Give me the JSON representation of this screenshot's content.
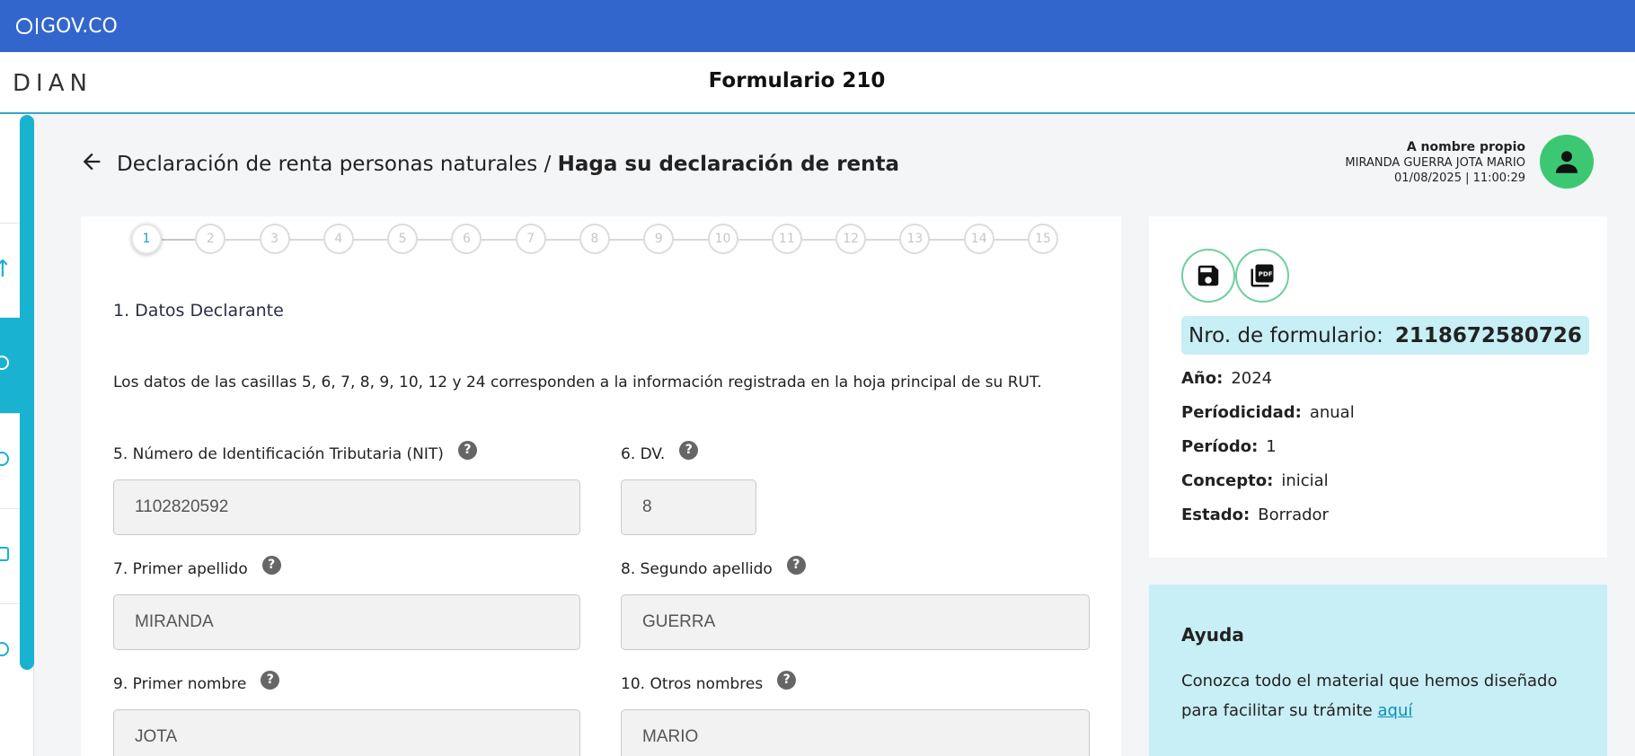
{
  "gov_bar": {
    "logo_text": "GOV.CO"
  },
  "app_bar": {
    "brand": "DIAN",
    "title": "Formulario 210"
  },
  "breadcrumb": {
    "parent": "Declaración de renta personas naturales",
    "separator": " / ",
    "current": "Haga su declaración de renta"
  },
  "user": {
    "role": "A nombre propio",
    "name": "MIRANDA GUERRA JOTA MARIO",
    "datetime": "01/08/2025 | 11:00:29"
  },
  "stepper": {
    "active": 1,
    "steps": [
      "1",
      "2",
      "3",
      "4",
      "5",
      "6",
      "7",
      "8",
      "9",
      "10",
      "11",
      "12",
      "13",
      "14",
      "15"
    ]
  },
  "section": {
    "title": "1. Datos Declarante",
    "intro": "Los datos de las casillas 5, 6, 7, 8, 9, 10, 12 y 24 corresponden a la información registrada en la hoja principal de su RUT.",
    "help_glyph": "?",
    "fields": {
      "nit": {
        "label": "5. Número de Identificación Tributaria (NIT)",
        "value": "1102820592"
      },
      "dv": {
        "label": "6. DV.",
        "value": "8"
      },
      "apellido1": {
        "label": "7. Primer apellido",
        "value": "MIRANDA"
      },
      "apellido2": {
        "label": "8. Segundo apellido",
        "value": "GUERRA"
      },
      "nombre1": {
        "label": "9. Primer nombre",
        "value": "JOTA"
      },
      "nombre2": {
        "label": "10. Otros nombres",
        "value": "MARIO"
      }
    }
  },
  "summary": {
    "nro_label": "Nro. de formulario:",
    "nro_value": "2118672580726",
    "anio_label": "Año:",
    "anio_value": "2024",
    "periodicidad_label": "Períodicidad:",
    "periodicidad_value": "anual",
    "periodo_label": "Período:",
    "periodo_value": "1",
    "concepto_label": "Concepto:",
    "concepto_value": "inicial",
    "estado_label": "Estado:",
    "estado_value": "Borrador"
  },
  "ayuda": {
    "title": "Ayuda",
    "text_line1": "Conozca todo el material que hemos diseñado",
    "text_line2": "para facilitar su trámite ",
    "link": "aquí"
  },
  "colors": {
    "gov_blue": "#3366cc",
    "accent_cyan": "#19b2d0",
    "avatar_green": "#3cc872",
    "help_bg": "#c8eef6"
  }
}
